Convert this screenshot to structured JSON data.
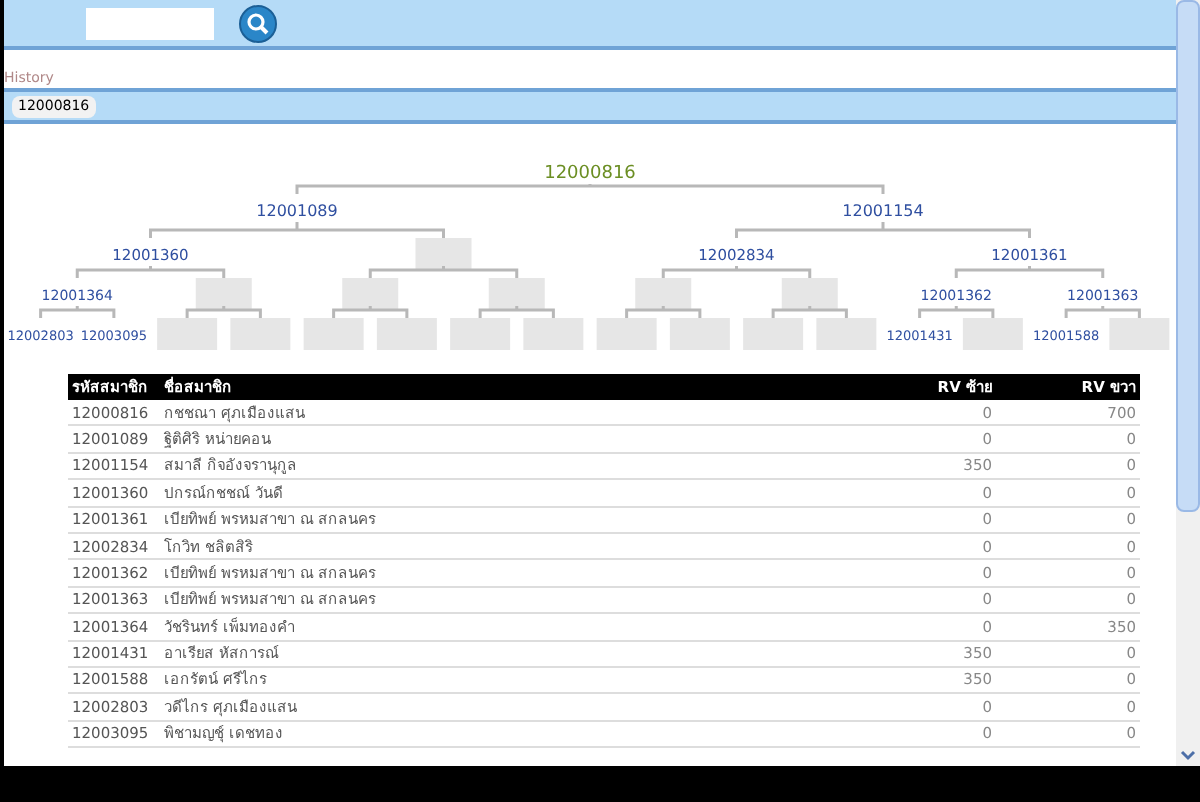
{
  "history": {
    "label": "History",
    "items": [
      "12000816"
    ]
  },
  "tree": {
    "label": "12000816",
    "kind": "root",
    "children": [
      {
        "label": "12001089",
        "kind": "member",
        "children": [
          {
            "label": "12001360",
            "kind": "member",
            "children": [
              {
                "label": "12001364",
                "kind": "member",
                "children": [
                  {
                    "label": "12002803",
                    "kind": "member"
                  },
                  {
                    "label": "12003095",
                    "kind": "member"
                  }
                ]
              },
              {
                "kind": "vacant",
                "children": [
                  {
                    "kind": "vacant"
                  },
                  {
                    "kind": "vacant"
                  }
                ]
              }
            ]
          },
          {
            "kind": "vacant",
            "children": [
              {
                "kind": "vacant",
                "children": [
                  {
                    "kind": "vacant"
                  },
                  {
                    "kind": "vacant"
                  }
                ]
              },
              {
                "kind": "vacant",
                "children": [
                  {
                    "kind": "vacant"
                  },
                  {
                    "kind": "vacant"
                  }
                ]
              }
            ]
          }
        ]
      },
      {
        "label": "12001154",
        "kind": "member",
        "children": [
          {
            "label": "12002834",
            "kind": "member",
            "children": [
              {
                "kind": "vacant",
                "children": [
                  {
                    "kind": "vacant"
                  },
                  {
                    "kind": "vacant"
                  }
                ]
              },
              {
                "kind": "vacant",
                "children": [
                  {
                    "kind": "vacant"
                  },
                  {
                    "kind": "vacant"
                  }
                ]
              }
            ]
          },
          {
            "label": "12001361",
            "kind": "member",
            "children": [
              {
                "label": "12001362",
                "kind": "member",
                "children": [
                  {
                    "label": "12001431",
                    "kind": "member"
                  },
                  {
                    "kind": "vacant"
                  }
                ]
              },
              {
                "label": "12001363",
                "kind": "member",
                "children": [
                  {
                    "label": "12001588",
                    "kind": "member"
                  },
                  {
                    "kind": "vacant"
                  }
                ]
              }
            ]
          }
        ]
      }
    ]
  },
  "table": {
    "columns": [
      "รหัสสมาชิก",
      "ชื่อสมาชิก",
      "RV ซ้าย",
      "RV ขวา"
    ],
    "rows": [
      [
        "12000816",
        "กชชณา ศุภเมืองแสน",
        "0",
        "700"
      ],
      [
        "12001089",
        "ฐิติศิริ หน่ายคอน",
        "0",
        "0"
      ],
      [
        "12001154",
        "สมาลี กิจอังจรานุกูล",
        "350",
        "0"
      ],
      [
        "12001360",
        "ปกรณ์กชชณ์ วันดี",
        "0",
        "0"
      ],
      [
        "12001361",
        "เบียทิพย์ พรหมสาขา ณ สกลนคร",
        "0",
        "0"
      ],
      [
        "12002834",
        "โกวิท ชลิตสิริ",
        "0",
        "0"
      ],
      [
        "12001362",
        "เบียทิพย์ พรหมสาขา ณ สกลนคร",
        "0",
        "0"
      ],
      [
        "12001363",
        "เบียทิพย์ พรหมสาขา ณ สกลนคร",
        "0",
        "0"
      ],
      [
        "12001364",
        "วัชรินทร์ เพ็มทองคำ",
        "0",
        "350"
      ],
      [
        "12001431",
        "อาเรียส หัสการณ์",
        "350",
        "0"
      ],
      [
        "12001588",
        "เอกรัตน์ ศรีไกร",
        "350",
        "0"
      ],
      [
        "12002803",
        "วดีไกร ศุภเมืองแสน",
        "0",
        "0"
      ],
      [
        "12003095",
        "พิชามญชุ์ เดชทอง",
        "0",
        "0"
      ]
    ]
  }
}
